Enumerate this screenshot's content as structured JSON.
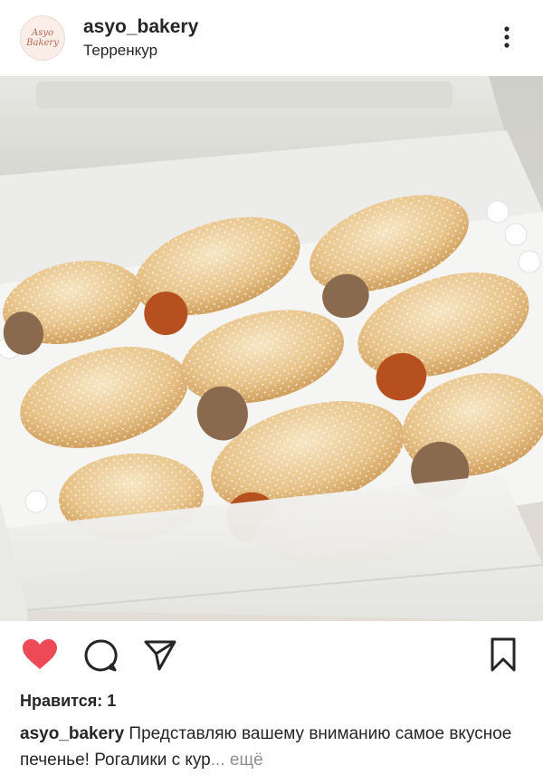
{
  "post": {
    "username": "asyo_bakery",
    "location": "Терренкур",
    "avatar": {
      "line1": "Asyo",
      "line2": "Bakery"
    },
    "image_alt": "Рогалики в коробке",
    "likes_text": "Нравится: 1",
    "caption_user": "asyo_bakery",
    "caption_text": " Представляю вашему вниманию самое вкусное печенье! Рогалики с кур",
    "caption_more": "... ещё"
  },
  "icons": {
    "menu": "more-vertical-icon",
    "like": "heart-filled-icon",
    "comment": "comment-icon",
    "share": "send-icon",
    "save": "bookmark-icon"
  },
  "colors": {
    "like": "#ed4956",
    "text": "#262626",
    "muted": "#8e8e8e"
  }
}
